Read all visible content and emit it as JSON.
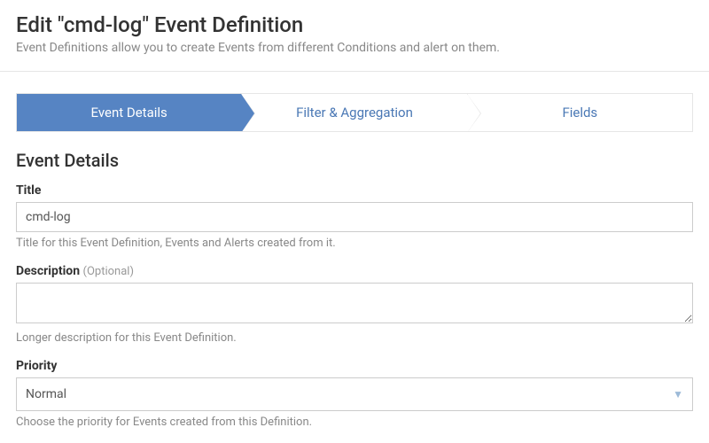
{
  "header": {
    "title": "Edit \"cmd-log\" Event Definition",
    "subtitle": "Event Definitions allow you to create Events from different Conditions and alert on them."
  },
  "steps": {
    "items": [
      {
        "label": "Event Details",
        "active": true
      },
      {
        "label": "Filter & Aggregation",
        "active": false
      },
      {
        "label": "Fields",
        "active": false
      }
    ]
  },
  "form": {
    "section_heading": "Event Details",
    "title": {
      "label": "Title",
      "value": "cmd-log",
      "help": "Title for this Event Definition, Events and Alerts created from it."
    },
    "description": {
      "label": "Description",
      "optional_text": "(Optional)",
      "value": "",
      "help": "Longer description for this Event Definition."
    },
    "priority": {
      "label": "Priority",
      "selected": "Normal",
      "help": "Choose the priority for Events created from this Definition."
    }
  }
}
